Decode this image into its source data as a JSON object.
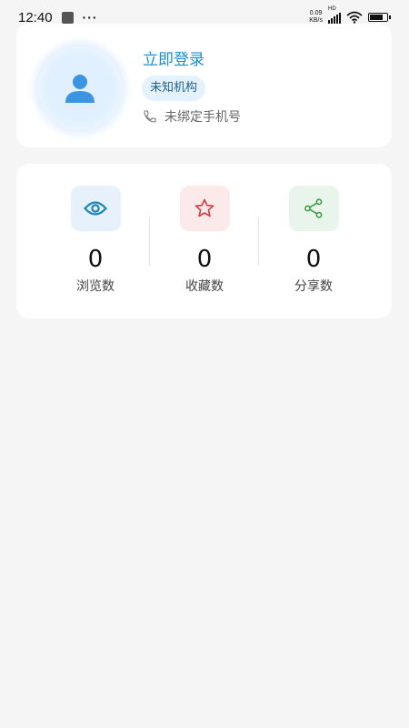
{
  "status_bar": {
    "time": "12:40",
    "more": "···",
    "net_speed_value": "0.09",
    "net_speed_unit": "KB/s",
    "signal_label": "HD",
    "battery_level": 0.85
  },
  "profile": {
    "login_text": "立即登录",
    "org_label": "未知机构",
    "phone_text": "未绑定手机号"
  },
  "stats": [
    {
      "value": "0",
      "label": "浏览数",
      "icon": "eye-icon",
      "bg": "#e6f1fc",
      "color": "#1f86b8"
    },
    {
      "value": "0",
      "label": "收藏数",
      "icon": "star-icon",
      "bg": "#fce9ea",
      "color": "#d13b45"
    },
    {
      "value": "0",
      "label": "分享数",
      "icon": "share-icon",
      "bg": "#e9f5ea",
      "color": "#3a9a3f"
    }
  ],
  "colors": {
    "accent": "#1a8fd0",
    "background": "#f5f5f5",
    "card": "#ffffff"
  }
}
